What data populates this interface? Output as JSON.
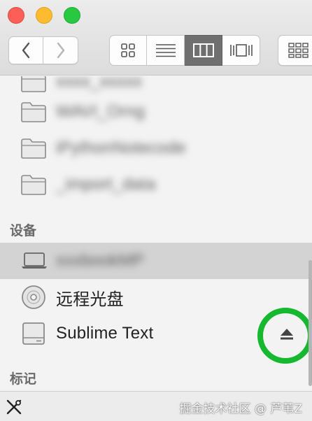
{
  "toolbar": {
    "views": [
      "icon-view",
      "list-view",
      "column-view",
      "gallery-view"
    ],
    "active_view": "column-view"
  },
  "sidebar": {
    "favorites": [
      {
        "label": "xxxx_xxxxx"
      },
      {
        "label": "WAVI_Orng"
      },
      {
        "label": "iPythonNotecode"
      },
      {
        "label": "_import_data"
      }
    ],
    "devices_label": "设备",
    "devices": [
      {
        "label": "xxxbookMP",
        "selected": true
      },
      {
        "label": "远程光盘"
      },
      {
        "label": "Sublime Text"
      }
    ],
    "tags_label": "标记"
  },
  "footer": {
    "watermark": "掘金技术社区 @ 芦苇Z"
  },
  "colors": {
    "highlight_ring": "#15b82e",
    "selected_row": "#d3d3d3"
  }
}
